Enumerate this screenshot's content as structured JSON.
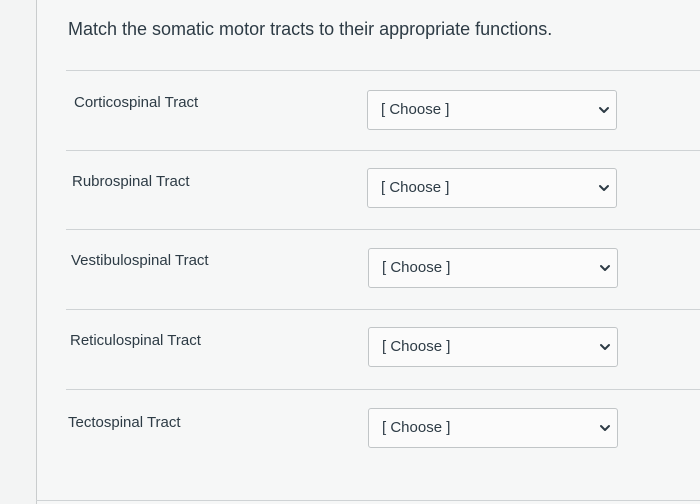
{
  "question": {
    "prompt": "Match the somatic motor tracts to their appropriate functions."
  },
  "rows": [
    {
      "label": "Corticospinal Tract",
      "selected": "[ Choose ]",
      "icon": "chevron-down-icon"
    },
    {
      "label": "Rubrospinal Tract",
      "selected": "[ Choose ]",
      "icon": "chevron-down-icon"
    },
    {
      "label": "Vestibulospinal Tract",
      "selected": "[ Choose ]",
      "icon": "chevron-down-icon"
    },
    {
      "label": "Reticulospinal Tract",
      "selected": "[ Choose ]",
      "icon": "chevron-down-icon"
    },
    {
      "label": "Tectospinal Tract",
      "selected": "[ Choose ]",
      "icon": "chevron-down-icon"
    }
  ]
}
